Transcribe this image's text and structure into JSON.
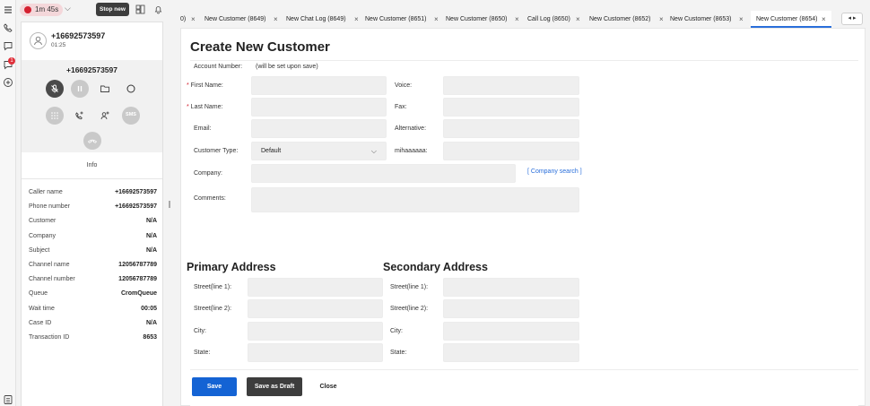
{
  "call": {
    "timer": "1m 45s",
    "stop_label": "Stop new",
    "number": "+16692573597",
    "duration": "01:25",
    "dial_number": "+16692573597",
    "sms_label": "SMS",
    "info_tab": "Info",
    "rail_badge": "1"
  },
  "details": [
    {
      "key": "Caller name",
      "value": "+16692573597"
    },
    {
      "key": "Phone number",
      "value": "+16692573597"
    },
    {
      "key": "Customer",
      "value": "N/A"
    },
    {
      "key": "Company",
      "value": "N/A"
    },
    {
      "key": "Subject",
      "value": "N/A"
    },
    {
      "key": "Channel name",
      "value": "12056787789"
    },
    {
      "key": "Channel number",
      "value": "12056787789"
    },
    {
      "key": "Queue",
      "value": "CromQueue"
    },
    {
      "key": "Wait time",
      "value": "00:05"
    },
    {
      "key": "Case ID",
      "value": "N/A"
    },
    {
      "key": "Transaction ID",
      "value": "8653"
    }
  ],
  "tabs": [
    {
      "label": "0)"
    },
    {
      "label": "New Customer (8649)"
    },
    {
      "label": "New Chat Log (8649)"
    },
    {
      "label": "New Customer (8651)"
    },
    {
      "label": "New Customer (8650)"
    },
    {
      "label": "Call Log (8650)"
    },
    {
      "label": "New Customer (8652)"
    },
    {
      "label": "New Customer (8653)"
    },
    {
      "label": "New Customer (8654)"
    }
  ],
  "tab_nav": "◂ ▸",
  "form": {
    "title": "Create New Customer",
    "account_label": "Account Number:",
    "account_value": "(will be set upon save)",
    "first_name": "First Name:",
    "last_name": "Last Name:",
    "email": "Email:",
    "customer_type": "Customer Type:",
    "customer_type_value": "Default",
    "company": "Company:",
    "company_search": "[ Company search ]",
    "comments": "Comments:",
    "voice": "Voice:",
    "fax": "Fax:",
    "alternative": "Alternative:",
    "custom": "mihaaaaaa:",
    "primary_title": "Primary Address",
    "secondary_title": "Secondary Address",
    "street1": "Street(line 1):",
    "street2": "Street(line 2):",
    "city": "City:",
    "state": "State:",
    "save": "Save",
    "save_draft": "Save as Draft",
    "close": "Close"
  }
}
